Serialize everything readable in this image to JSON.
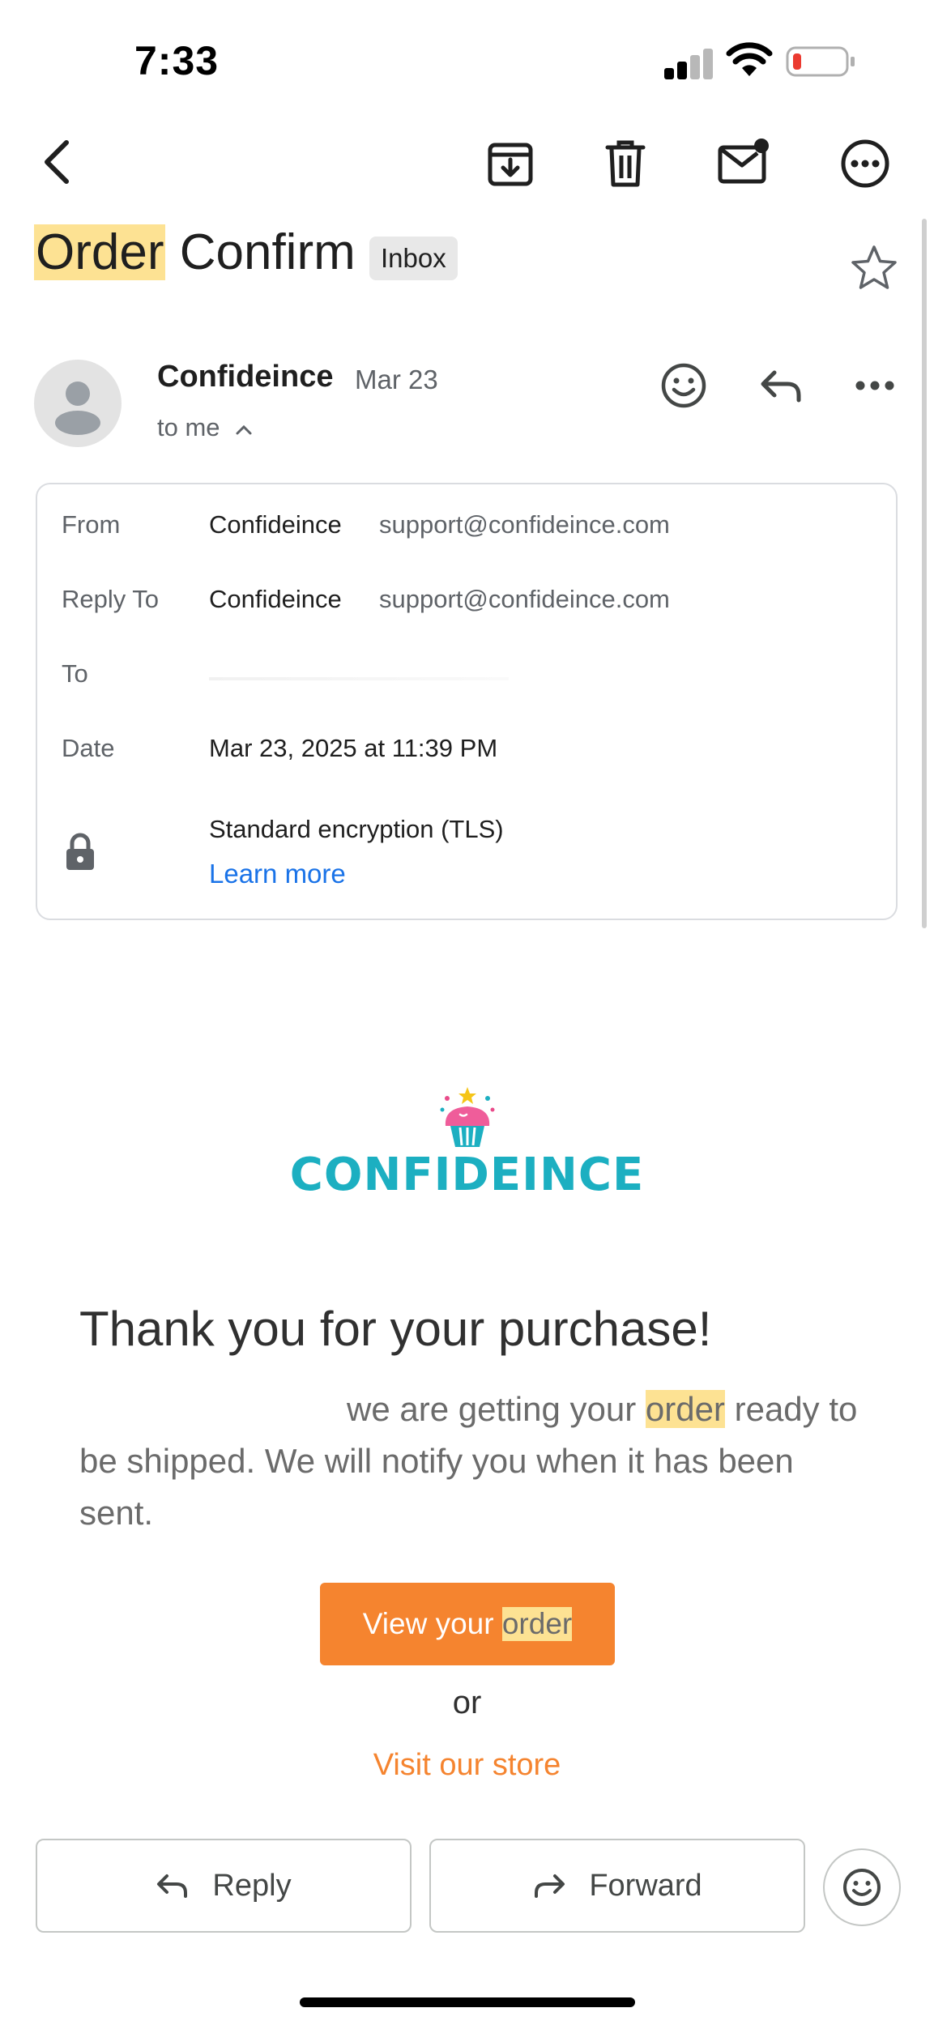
{
  "status_bar": {
    "time": "7:33"
  },
  "toolbar": {
    "back_icon": "chevron-left-icon",
    "archive_icon": "archive-icon",
    "delete_icon": "trash-icon",
    "mark_unread_icon": "mail-unread-icon",
    "more_icon": "more-horizontal-circle-icon"
  },
  "subject": {
    "highlight": "Order",
    "rest": " Confirm",
    "label": "Inbox"
  },
  "sender": {
    "name": "Confideince",
    "date": "Mar 23",
    "to_line": "to me"
  },
  "details": {
    "from_label": "From",
    "from_name": "Confideince",
    "from_email": "support@confideince.com",
    "reply_label": "Reply To",
    "reply_name": "Confideince",
    "reply_email": "support@confideince.com",
    "to_label": "To",
    "date_label": "Date",
    "date_value": "Mar 23, 2025 at 11:39 PM",
    "security_value": "Standard encryption (TLS)",
    "learn_more": "Learn more"
  },
  "body": {
    "brand": "CONFIDEINCE",
    "headline": "Thank you for your purchase!",
    "para_pre": "we are getting your ",
    "para_hl": "order",
    "para_post": " ready to be shipped. We will notify you when it has been sent.",
    "cta_pre": "View your ",
    "cta_hl": "order",
    "or": "or",
    "store_link": "Visit our store"
  },
  "actions": {
    "reply": "Reply",
    "forward": "Forward"
  },
  "colors": {
    "accent": "#f5842f",
    "brand": "#1cafc1",
    "highlight": "#fde293",
    "link": "#1a73e8"
  }
}
